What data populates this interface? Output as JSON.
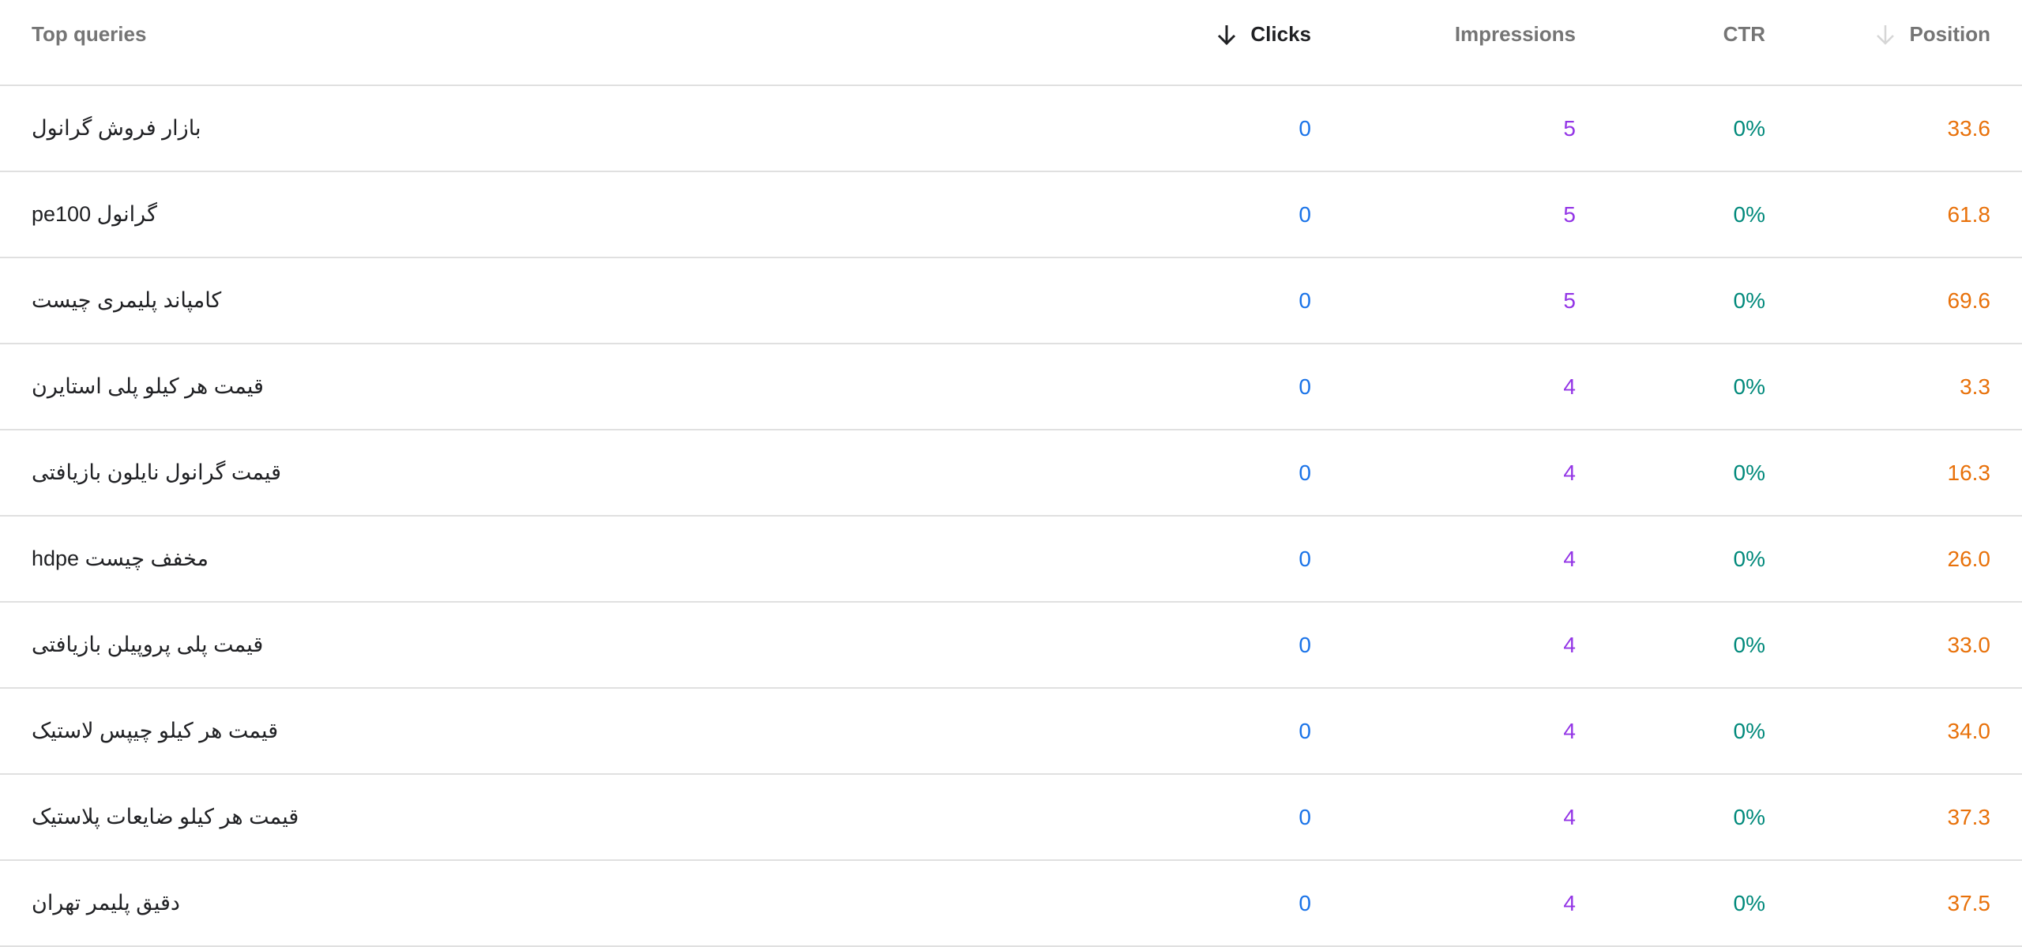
{
  "header": {
    "query": "Top queries",
    "clicks": "Clicks",
    "impressions": "Impressions",
    "ctr": "CTR",
    "position": "Position",
    "sort_icon": "arrow-down-icon"
  },
  "colors": {
    "clicks": "#1a73e8",
    "impressions": "#9334e6",
    "ctr": "#00897b",
    "position": "#e8710a"
  },
  "rows": [
    {
      "query": "بازار فروش گرانول",
      "clicks": "0",
      "impressions": "5",
      "ctr": "0%",
      "position": "33.6"
    },
    {
      "query": "گرانول pe100",
      "clicks": "0",
      "impressions": "5",
      "ctr": "0%",
      "position": "61.8"
    },
    {
      "query": "کامپاند پلیمری چیست",
      "clicks": "0",
      "impressions": "5",
      "ctr": "0%",
      "position": "69.6"
    },
    {
      "query": "قیمت هر کیلو پلی استایرن",
      "clicks": "0",
      "impressions": "4",
      "ctr": "0%",
      "position": "3.3"
    },
    {
      "query": "قیمت گرانول نایلون بازیافتی",
      "clicks": "0",
      "impressions": "4",
      "ctr": "0%",
      "position": "16.3"
    },
    {
      "query": "مخفف چیست hdpe",
      "clicks": "0",
      "impressions": "4",
      "ctr": "0%",
      "position": "26.0"
    },
    {
      "query": "قیمت پلی پروپیلن بازیافتی",
      "clicks": "0",
      "impressions": "4",
      "ctr": "0%",
      "position": "33.0"
    },
    {
      "query": "قیمت هر کیلو چیپس لاستیک",
      "clicks": "0",
      "impressions": "4",
      "ctr": "0%",
      "position": "34.0"
    },
    {
      "query": "قیمت هر کیلو ضایعات پلاستیک",
      "clicks": "0",
      "impressions": "4",
      "ctr": "0%",
      "position": "37.3"
    },
    {
      "query": "دقیق پلیمر تهران",
      "clicks": "0",
      "impressions": "4",
      "ctr": "0%",
      "position": "37.5"
    }
  ]
}
